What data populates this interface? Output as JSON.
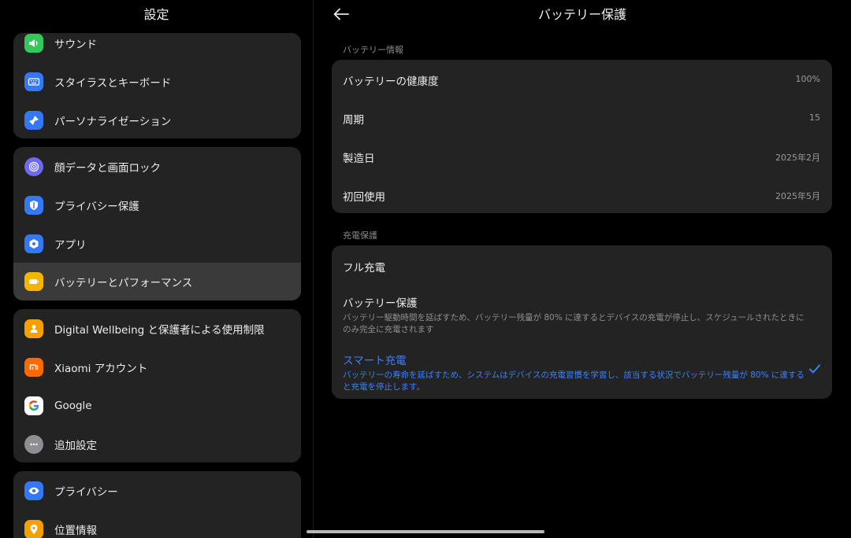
{
  "left_pane": {
    "title": "設定",
    "groups": [
      {
        "items": [
          {
            "label": "サウンド",
            "icon": "sound-icon",
            "color": "#34c759"
          },
          {
            "label": "スタイラスとキーボード",
            "icon": "keyboard-icon",
            "color": "#3478f6"
          },
          {
            "label": "パーソナライゼーション",
            "icon": "personalization-icon",
            "color": "#3478f6"
          }
        ]
      },
      {
        "items": [
          {
            "label": "顔データと画面ロック",
            "icon": "face-lock-icon",
            "color": "#6e6af0"
          },
          {
            "label": "プライバシー保護",
            "icon": "privacy-shield-icon",
            "color": "#3478f6"
          },
          {
            "label": "アプリ",
            "icon": "apps-icon",
            "color": "#3478f6"
          },
          {
            "label": "バッテリーとパフォーマンス",
            "icon": "battery-icon",
            "color": "#f4b400"
          }
        ]
      },
      {
        "items": [
          {
            "label": "Digital Wellbeing と保護者による使用制限",
            "icon": "wellbeing-icon",
            "color": "#f4a000"
          },
          {
            "label": "Xiaomi アカウント",
            "icon": "xiaomi-icon",
            "color": "#ff6900"
          },
          {
            "label": "Google",
            "icon": "google-icon",
            "color": "#ffffff"
          },
          {
            "label": "追加設定",
            "icon": "more-icon",
            "color": "#8e8e93"
          }
        ]
      },
      {
        "items": [
          {
            "label": "プライバシー",
            "icon": "eye-icon",
            "color": "#3478f6"
          },
          {
            "label": "位置情報",
            "icon": "location-icon",
            "color": "#f4a000"
          }
        ]
      }
    ]
  },
  "right_pane": {
    "title": "バッテリー保護",
    "info_section": {
      "label": "バッテリー情報",
      "rows": [
        {
          "key": "バッテリーの健康度",
          "value": "100%"
        },
        {
          "key": "周期",
          "value": "15"
        },
        {
          "key": "製造日",
          "value": "2025年2月"
        },
        {
          "key": "初回使用",
          "value": "2025年5月"
        }
      ]
    },
    "charge_section": {
      "label": "充電保護",
      "options": [
        {
          "title": "フル充電",
          "desc": ""
        },
        {
          "title": "バッテリー保護",
          "desc": "バッテリー駆動時間を延ばすため、バッテリー残量が 80% に達するとデバイスの充電が停止し、スケジュールされたときにのみ完全に充電されます"
        },
        {
          "title": "スマート充電",
          "desc": "バッテリーの寿命を延ばすため、システムはデバイスの充電習慣を学習し、該当する状況でバッテリー残量が 80% に達すると充電を停止します。"
        }
      ],
      "selected": "スマート充電"
    }
  },
  "colors": {
    "accent": "#3b82f6",
    "card": "#232323",
    "background": "#000000"
  }
}
